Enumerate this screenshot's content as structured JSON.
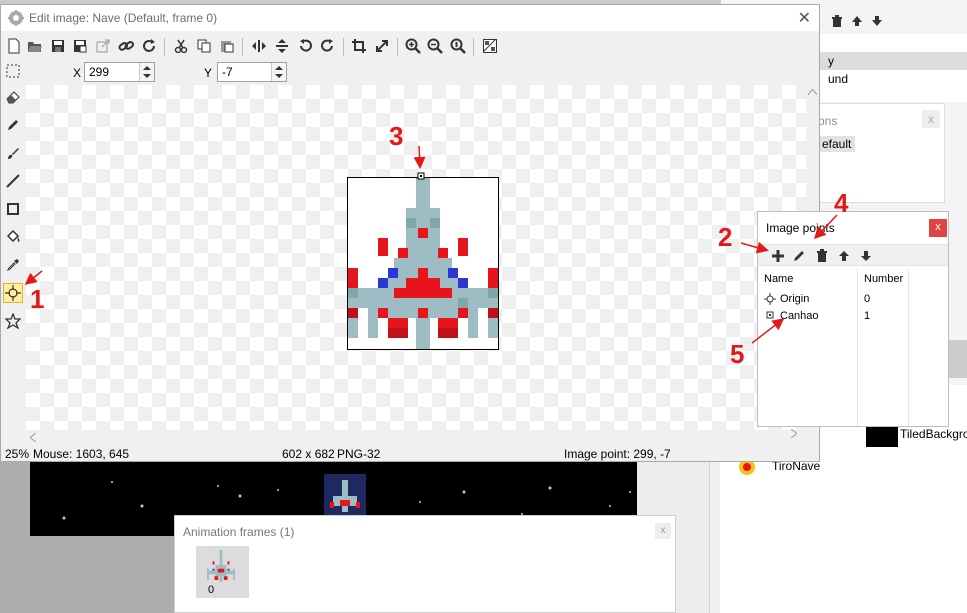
{
  "window": {
    "title": "Edit image: Nave (Default, frame 0)",
    "close_glyph": "✕"
  },
  "toolbar": {
    "icons": [
      "new-icon",
      "open-icon",
      "save-icon",
      "save-as-icon",
      "export-icon",
      "link-icon",
      "refresh-icon",
      "cut-icon",
      "copy-icon",
      "paste-icon",
      "flip-horizontal-icon",
      "flip-vertical-icon",
      "rotate-left-icon",
      "rotate-right-icon",
      "crop-icon",
      "resize-icon",
      "zoom-in-icon",
      "zoom-out-icon",
      "zoom-reset-icon",
      "grid-icon"
    ]
  },
  "coords": {
    "x_label": "X",
    "x_value": "299",
    "y_label": "Y",
    "y_value": "-7"
  },
  "tools": [
    "select-icon",
    "eraser-icon",
    "pencil-icon",
    "brush-icon",
    "line-icon",
    "rectangle-icon",
    "fill-icon",
    "color-picker-icon",
    "image-point-tool-icon",
    "polygon-icon"
  ],
  "active_tool": "image-point-tool-icon",
  "status": {
    "zoom": "25%",
    "mouse": "Mouse: 1603, 645",
    "size": "602 x 682",
    "format": "PNG-32",
    "image_point": "Image point: 299, -7"
  },
  "image_points": {
    "title": "Image points",
    "close_glyph": "x",
    "col_name": "Name",
    "col_number": "Number",
    "rows": [
      {
        "name": "Origin",
        "number": "0"
      },
      {
        "name": "Canhao",
        "number": "1"
      }
    ],
    "toolbar_icons": [
      "add-icon",
      "edit-icon",
      "delete-icon",
      "move-up-icon",
      "move-down-icon"
    ]
  },
  "animation_frames": {
    "title": "Animation frames (1)",
    "close_glyph": "x",
    "frames": [
      {
        "index": "0"
      }
    ]
  },
  "background": {
    "tree_row_1": "y",
    "tree_row_2": "und",
    "floating_title": "ons",
    "floating_item": "efault",
    "asset_1": "TiledBackgro",
    "asset_2": "TiroNave"
  },
  "annotations": [
    "1",
    "2",
    "3",
    "4",
    "5"
  ],
  "colors": {
    "annotation": "#e31919",
    "ship_red": "#e8141c",
    "ship_gray": "#9dbcc3",
    "ship_blue": "#2a36d6",
    "active_tool_bg": "#ffef9e"
  }
}
